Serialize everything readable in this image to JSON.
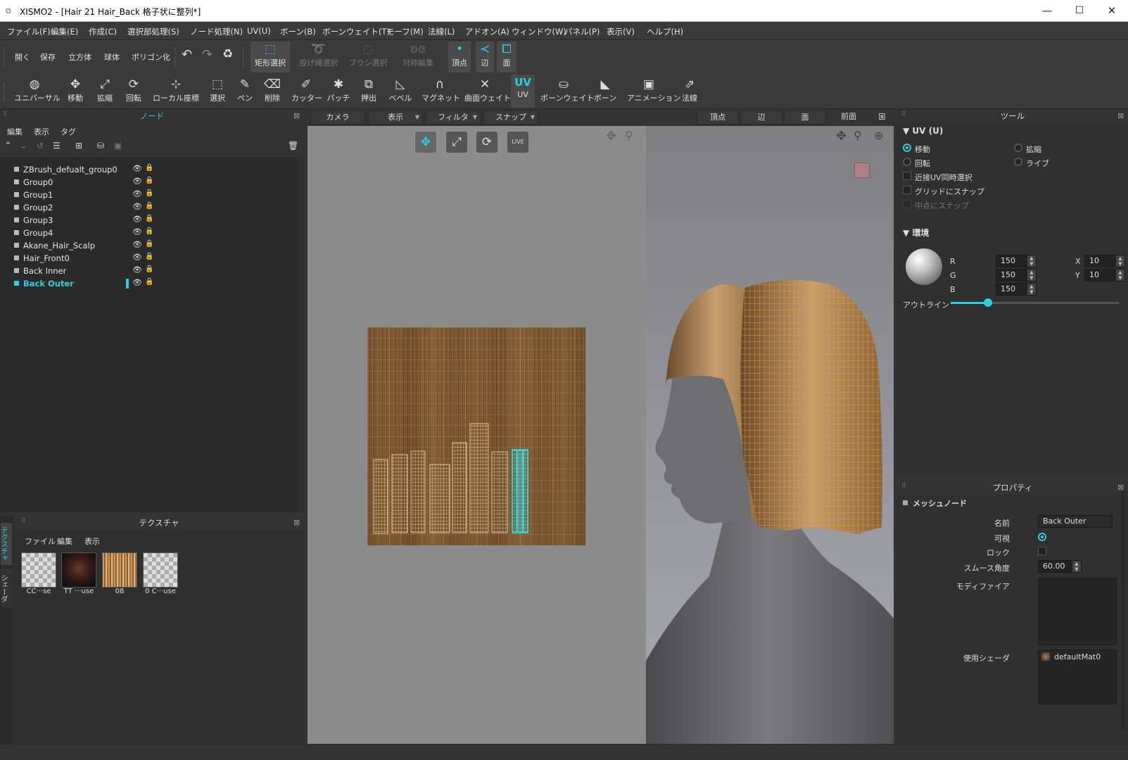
{
  "window": {
    "title": "XISMO2 - [Hair 21 Hair_Back 格子状に整列*]",
    "minimize": "—",
    "maximize": "☐",
    "close": "✕"
  },
  "menu": [
    "ファイル(F)",
    "編集(E)",
    "作成(C)",
    "選択部処理(S)",
    "ノード処理(N)",
    "UV(U)",
    "ボーン(B)",
    "ボーンウェイト(T)",
    "モーフ(M)",
    "法線(L)",
    "アドオン(A)",
    "ウィンドウ(W)",
    "パネル(P)",
    "表示(V)",
    "ヘルプ(H)"
  ],
  "toolbar1": {
    "open": "開く",
    "save": "保存",
    "cube": "立方体",
    "sphere": "球体",
    "polygonize": "ポリゴン化",
    "rect_select": "矩形選択",
    "lasso_select": "投げ縄選択",
    "brush_select": "ブラシ選択",
    "symmetry": "対称編集",
    "vertex": "頂点",
    "edge": "辺",
    "face": "面"
  },
  "toolbar2": [
    "ユニバーサル",
    "移動",
    "拡縮",
    "回転",
    "ローカル座標",
    "選択",
    "ペン",
    "削除",
    "カッター",
    "パッチ",
    "押出",
    "ベベル",
    "マグネット",
    "曲面ウェイト",
    "UV",
    "ボーンウェイト",
    "ボーン",
    "アニメーション",
    "法線"
  ],
  "node_panel": {
    "title": "ノード",
    "menu": [
      "編集",
      "表示",
      "タグ"
    ],
    "nodes": [
      "ZBrush_defualt_group0",
      "Group0",
      "Group1",
      "Group2",
      "Group3",
      "Group4",
      "Akane_Hair_Scalp",
      "Hair_Front0",
      "Back Inner",
      "Back Outer"
    ],
    "selected": "Back Outer"
  },
  "texture_panel": {
    "title": "テクスチャ",
    "menu": [
      "ファイル",
      "編集",
      "表示"
    ],
    "side_tabs": [
      "テクスチャ",
      "シェーダ"
    ],
    "items": [
      "CC···se",
      "TT ···use",
      "08",
      "0 C···use"
    ]
  },
  "uv_view": {
    "dropdowns": [
      "カメラ",
      "表示",
      "フィルタ",
      "スナップ"
    ],
    "buttons": [
      "move",
      "scale",
      "rotate",
      "live"
    ],
    "live_label": "LIVE"
  },
  "view3d": {
    "buttons": [
      "頂点",
      "辺",
      "面",
      "前面"
    ]
  },
  "tool_panel": {
    "title": "ツール",
    "uv_section": "UV (U)",
    "move": "移動",
    "scale": "拡縮",
    "rotate": "回転",
    "live": "ライブ",
    "near_uv": "近接UV同時選択",
    "grid_snap": "グリッドにスナップ",
    "mid_snap": "中点にスナップ",
    "env_section": "環境",
    "r_label": "R",
    "g_label": "G",
    "b_label": "B",
    "r": "150",
    "g": "150",
    "b": "150",
    "x_label": "X",
    "y_label": "Y",
    "x": "10",
    "y": "10",
    "outline": "アウトライン",
    "outline_value": 0.22
  },
  "property_panel": {
    "title": "プロパティ",
    "section": "メッシュノード",
    "name_label": "名前",
    "name": "Back Outer",
    "visible_label": "可視",
    "lock_label": "ロック",
    "smooth_label": "スムース角度",
    "smooth": "60.00",
    "modifier_label": "モディファイア",
    "shader_label": "使用シェーダ",
    "shader": "defaultMat0"
  },
  "colors": {
    "accent": "#2bd0e3",
    "panel": "#2f2f2f",
    "selection_hair": "#f0a030"
  }
}
